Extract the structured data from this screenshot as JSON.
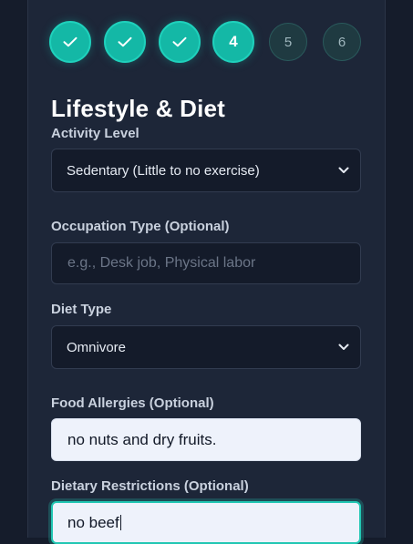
{
  "stepper": {
    "steps": [
      {
        "state": "done",
        "icon": "check-icon"
      },
      {
        "state": "done",
        "icon": "check-icon"
      },
      {
        "state": "done",
        "icon": "check-icon"
      },
      {
        "state": "current",
        "label": "4"
      },
      {
        "state": "upcoming",
        "label": "5"
      },
      {
        "state": "upcoming",
        "label": "6"
      }
    ],
    "accent": "#14b8a6"
  },
  "section": {
    "title": "Lifestyle & Diet"
  },
  "fields": {
    "activity": {
      "label": "Activity Level",
      "value": "Sedentary (Little to no exercise)"
    },
    "occupation": {
      "label": "Occupation Type (Optional)",
      "placeholder": "e.g., Desk job, Physical labor"
    },
    "diet": {
      "label": "Diet Type",
      "value": "Omnivore"
    },
    "allergies": {
      "label": "Food Allergies (Optional)",
      "value": "no nuts and dry fruits."
    },
    "restrictions": {
      "label": "Dietary Restrictions (Optional)",
      "value": "no beef"
    }
  }
}
